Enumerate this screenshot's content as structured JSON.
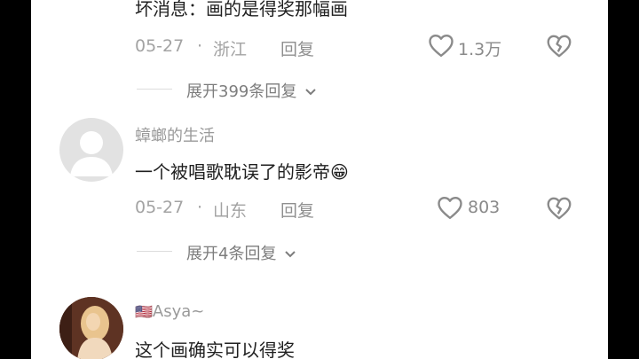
{
  "comments": [
    {
      "text": "坏消息：画的是得奖那幅画",
      "date": "05-27",
      "separator": "·",
      "location": "浙江",
      "reply_label": "回复",
      "likes": "1.3万",
      "expand_label": "展开399条回复"
    },
    {
      "username": "蟑螂的生活",
      "text": "一个被唱歌耽误了的影帝",
      "emoji": "😁",
      "date": "05-27",
      "separator": "·",
      "location": "山东",
      "reply_label": "回复",
      "likes": "803",
      "expand_label": "展开4条回复"
    },
    {
      "username": "Asya~",
      "flag": "🇺🇸",
      "text": "这个画确实可以得奖"
    }
  ],
  "icons": {
    "like": "heart-outline-icon",
    "dislike": "broken-heart-icon",
    "expand": "chevron-down-icon"
  },
  "colors": {
    "text": "#1f1f1f",
    "meta": "#a3a3a3",
    "background": "#ffffff"
  }
}
